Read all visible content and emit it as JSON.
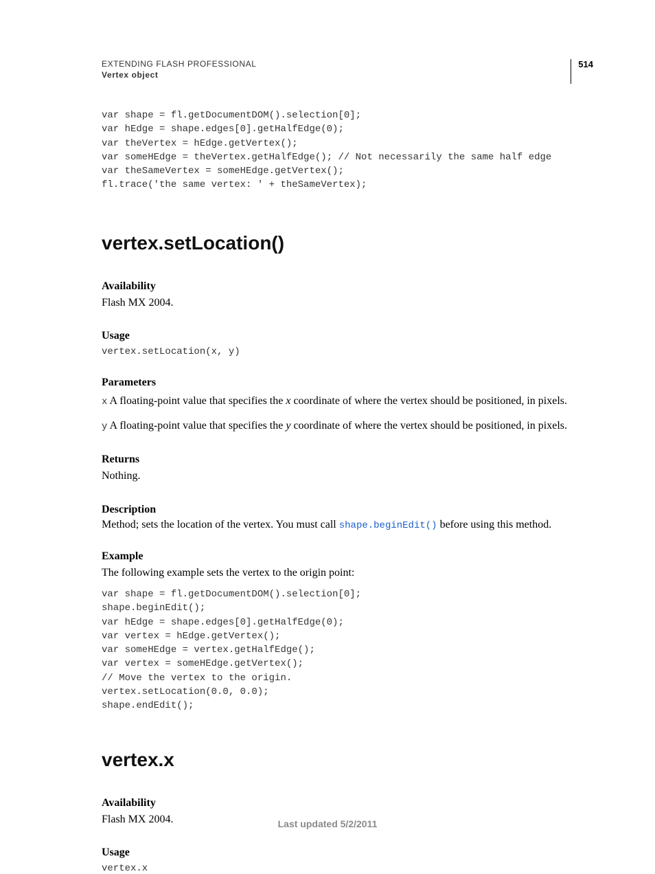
{
  "header": {
    "line1": "EXTENDING FLASH PROFESSIONAL",
    "line2": "Vertex object",
    "pageNumber": "514"
  },
  "codeTop": "var shape = fl.getDocumentDOM().selection[0];\nvar hEdge = shape.edges[0].getHalfEdge(0);\nvar theVertex = hEdge.getVertex();\nvar someHEdge = theVertex.getHalfEdge(); // Not necessarily the same half edge\nvar theSameVertex = someHEdge.getVertex();\nfl.trace('the same vertex: ' + theSameVertex);",
  "section1": {
    "title": "vertex.setLocation()",
    "availabilityLabel": "Availability",
    "availabilityText": "Flash MX 2004.",
    "usageLabel": "Usage",
    "usageCode": "vertex.setLocation(x, y)",
    "parametersLabel": "Parameters",
    "paramX": {
      "code": "x",
      "pre": "  A floating-point value that specifies the ",
      "italic": "x",
      "post": " coordinate of where the vertex should be positioned, in pixels."
    },
    "paramY": {
      "code": "y",
      "pre": "  A floating-point value that specifies the ",
      "italic": "y",
      "post": " coordinate of where the vertex should be positioned, in pixels."
    },
    "returnsLabel": "Returns",
    "returnsText": "Nothing.",
    "descriptionLabel": "Description",
    "descPre": "Method; sets the location of the vertex. You must call ",
    "descLink": "shape.beginEdit()",
    "descPost": " before using this method.",
    "exampleLabel": "Example",
    "exampleIntro": "The following example sets the vertex to the origin point:",
    "exampleCode": "var shape = fl.getDocumentDOM().selection[0];\nshape.beginEdit();\nvar hEdge = shape.edges[0].getHalfEdge(0);\nvar vertex = hEdge.getVertex();\nvar someHEdge = vertex.getHalfEdge();\nvar vertex = someHEdge.getVertex();\n// Move the vertex to the origin.\nvertex.setLocation(0.0, 0.0);\nshape.endEdit();"
  },
  "section2": {
    "title": "vertex.x",
    "availabilityLabel": "Availability",
    "availabilityText": "Flash MX 2004.",
    "usageLabel": "Usage",
    "usageCode": "vertex.x"
  },
  "footer": "Last updated 5/2/2011"
}
